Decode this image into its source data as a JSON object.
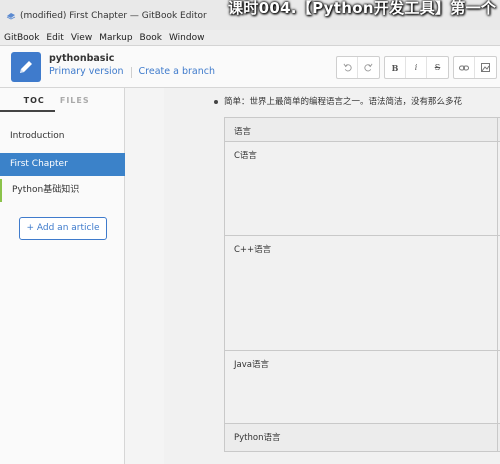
{
  "window": {
    "title": "(modified) First Chapter — GitBook Editor",
    "overlay_caption": "课时004.【Python开发工具】第一个"
  },
  "menubar": {
    "items": [
      "GitBook",
      "Edit",
      "View",
      "Markup",
      "Book",
      "Window"
    ]
  },
  "header": {
    "book_name": "pythonbasic",
    "branch_label": "Primary version",
    "create_branch_label": "Create a branch",
    "toolbar_icons": [
      "undo-icon",
      "redo-icon",
      "bold-icon",
      "italic-icon",
      "strikethrough-icon",
      "link-icon",
      "image-icon"
    ],
    "toolbar_glyphs": {
      "bold": "B",
      "italic": "i",
      "strike": "S"
    }
  },
  "sidebar": {
    "tabs": [
      {
        "label": "TOC",
        "active": true
      },
      {
        "label": "FILES",
        "active": false
      }
    ],
    "articles": [
      {
        "label": "Introduction",
        "active": false
      },
      {
        "label": "First Chapter",
        "active": true
      },
      {
        "label": "Python基础知识",
        "active": false
      }
    ],
    "add_article_label": "+ Add an article"
  },
  "editor": {
    "bullet_text": "简单：世界上最简单的编程语言之一。语法简洁，没有那么多花",
    "table": {
      "header": "语言",
      "rows": [
        "C语言",
        "C++语言",
        "Java语言",
        "Python语言"
      ]
    }
  },
  "colors": {
    "accent": "#3b82c9",
    "link": "#3f7bcc",
    "tree_marker": "#8bc34a"
  }
}
